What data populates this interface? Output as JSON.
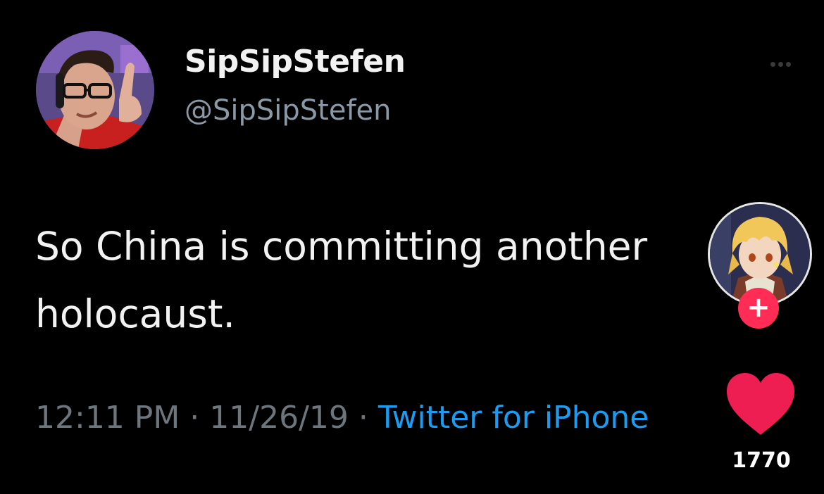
{
  "tweet": {
    "display_name": "SipSipStefen",
    "handle": "@SipSipStefen",
    "text": "So China is committing another holocaust.",
    "time": "12:11 PM",
    "date": "11/26/19",
    "source": "Twitter for iPhone"
  },
  "overlay": {
    "like_count": "1770",
    "follow_symbol": "+"
  },
  "icons": {
    "more": "more-horizontal-icon",
    "like": "heart-icon",
    "follow": "plus-icon"
  },
  "colors": {
    "background": "#000000",
    "accent_link": "#1d9bf0",
    "like_red": "#ee1d52",
    "follow_red": "#ff2c55"
  }
}
